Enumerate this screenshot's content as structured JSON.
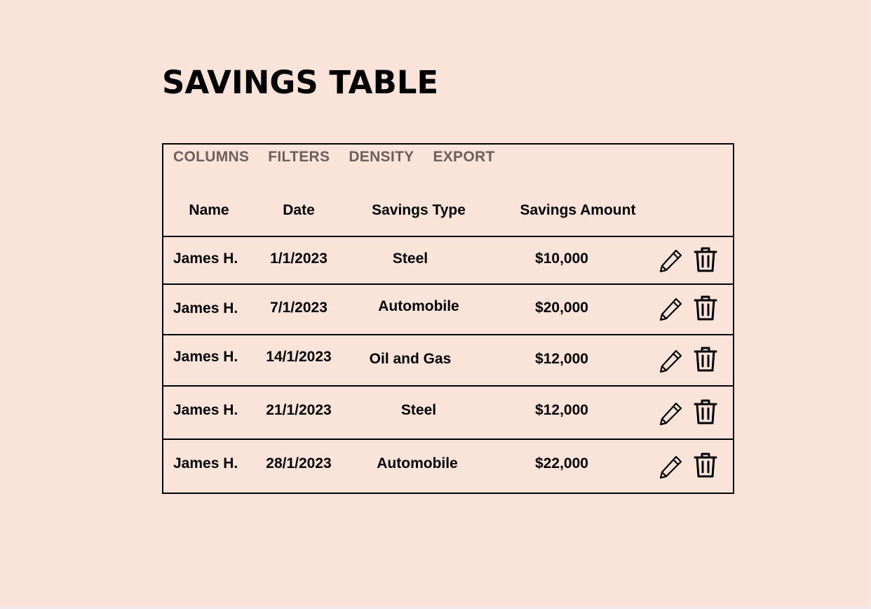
{
  "page": {
    "title": "SAVINGS TABLE"
  },
  "toolbar": {
    "columns_label": "COLUMNS",
    "filters_label": "FILTERS",
    "density_label": "DENSITY",
    "export_label": "EXPORT"
  },
  "table": {
    "headers": {
      "name": "Name",
      "date": "Date",
      "type": "Savings Type",
      "amount": "Savings Amount"
    },
    "rows": [
      {
        "name": "James H.",
        "date": "1/1/2023",
        "type": "Steel",
        "amount": "$10,000"
      },
      {
        "name": "James H.",
        "date": "7/1/2023",
        "type": "Automobile",
        "amount": "$20,000"
      },
      {
        "name": "James H.",
        "date": "14/1/2023",
        "type": "Oil and Gas",
        "amount": "$12,000"
      },
      {
        "name": "James H.",
        "date": "21/1/2023",
        "type": "Steel",
        "amount": "$12,000"
      },
      {
        "name": "James H.",
        "date": "28/1/2023",
        "type": "Automobile",
        "amount": "$22,000"
      }
    ],
    "row_actions": {
      "edit_icon": "pencil-icon",
      "delete_icon": "trash-icon"
    }
  },
  "colors": {
    "background": "#fae4da",
    "toolbar_text": "#6d5e5b",
    "text": "#000000"
  }
}
